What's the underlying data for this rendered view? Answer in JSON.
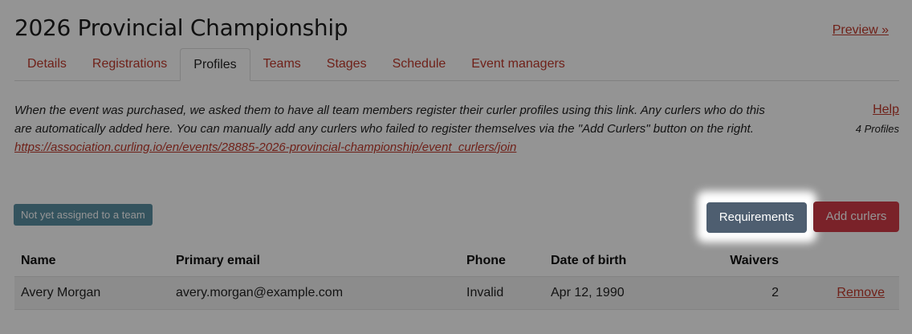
{
  "header": {
    "title": "2026 Provincial Championship",
    "preview_label": "Preview »"
  },
  "tabs": [
    {
      "label": "Details"
    },
    {
      "label": "Registrations"
    },
    {
      "label": "Profiles"
    },
    {
      "label": "Teams"
    },
    {
      "label": "Stages"
    },
    {
      "label": "Schedule"
    },
    {
      "label": "Event managers"
    }
  ],
  "description": {
    "text": "When the event was purchased, we asked them to have all team members register their curler profiles using this link. Any curlers who do this are automatically added here. You can manually add any curlers who failed to register themselves via the \"Add Curlers\" button on the right.",
    "link": "https://association.curling.io/en/events/28885-2026-provincial-championship/event_curlers/join"
  },
  "sidebar": {
    "help_label": "Help",
    "profile_count": "4 Profiles"
  },
  "filter": {
    "badge_label": "Not yet assigned to a team"
  },
  "actions": {
    "requirements_label": "Requirements",
    "add_curlers_label": "Add curlers"
  },
  "table": {
    "headers": {
      "name": "Name",
      "email": "Primary email",
      "phone": "Phone",
      "dob": "Date of birth",
      "waivers": "Waivers"
    },
    "rows": [
      {
        "name": "Avery Morgan",
        "email": "avery.morgan@example.com",
        "phone": "Invalid",
        "dob": "Apr 12, 1990",
        "waivers": "2",
        "action": "Remove"
      }
    ]
  },
  "colors": {
    "accent": "#c0392b",
    "requirements_button": "#4e5e70",
    "add_button": "#d23b47",
    "badge": "#5a8fa3"
  }
}
